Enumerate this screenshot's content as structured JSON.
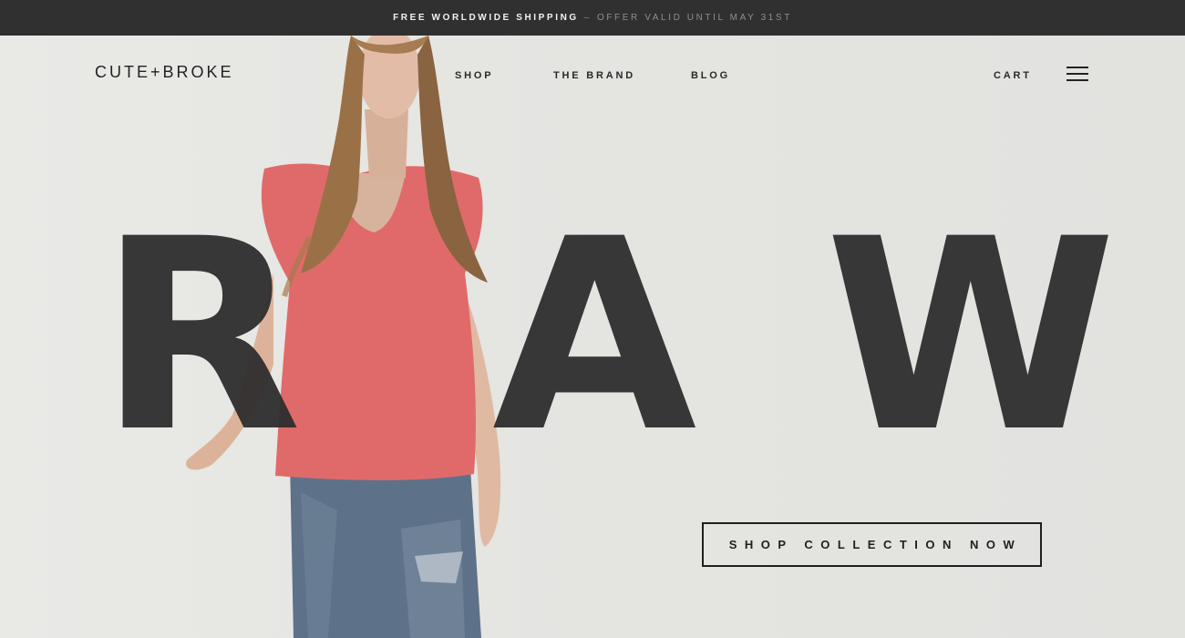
{
  "promo": {
    "main": "FREE WORLDWIDE SHIPPING",
    "separator": "–",
    "secondary": "OFFER VALID UNTIL MAY 31ST"
  },
  "header": {
    "logo": "CUTE+BROKE",
    "nav": [
      "SHOP",
      "THE BRAND",
      "BLOG"
    ],
    "cart": "CART",
    "menu_icon": "hamburger-menu-icon"
  },
  "hero": {
    "letters": [
      "R",
      "A",
      "W"
    ],
    "cta": "SHOP COLLECTION NOW"
  },
  "colors": {
    "promo_bar": "#303030",
    "background": "#e6e6e3",
    "text": "#2f2f2f",
    "shirt": "#e06a6a",
    "jeans": "#5d7288"
  }
}
